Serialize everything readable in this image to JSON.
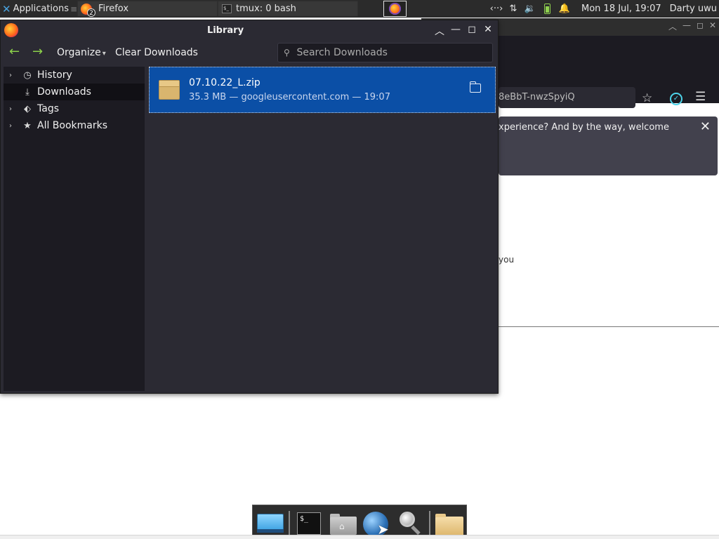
{
  "top_panel": {
    "apps_label": "Applications",
    "apps_sep": "≡",
    "tasks": [
      {
        "label": "Firefox",
        "badge": "2"
      },
      {
        "label": "tmux: 0 bash"
      }
    ],
    "tray": {
      "network": "‹··›",
      "transfer": "⇅",
      "volume": "🔉",
      "bell": "🔔",
      "clock": "Mon 18 Jul, 19:07",
      "user": "Darty uwu"
    }
  },
  "background_window": {
    "url_text": "8eBbT-nwzSpyiQ",
    "notification": "xperience? And by the way, welcome",
    "page_text": "you"
  },
  "library": {
    "title": "Library",
    "toolbar": {
      "back": "←",
      "forward": "→",
      "organize": "Organize",
      "clear_downloads": "Clear Downloads",
      "search_placeholder": "Search Downloads"
    },
    "sidebar": [
      {
        "label": "History",
        "icon": "clock-icon",
        "expandable": true
      },
      {
        "label": "Downloads",
        "icon": "download-icon",
        "expandable": false,
        "selected": true
      },
      {
        "label": "Tags",
        "icon": "tag-icon",
        "expandable": true
      },
      {
        "label": "All Bookmarks",
        "icon": "star-icon",
        "expandable": true
      }
    ],
    "downloads": [
      {
        "name": "07.10.22_L.zip",
        "meta": "35.3 MB — googleusercontent.com — 19:07"
      }
    ]
  },
  "dock": {
    "terminal_prompt": "$_"
  },
  "colors": {
    "accent_selection": "#0b4fa6",
    "panel": "#2b2b2b",
    "arrow_green": "#8cd14a"
  }
}
